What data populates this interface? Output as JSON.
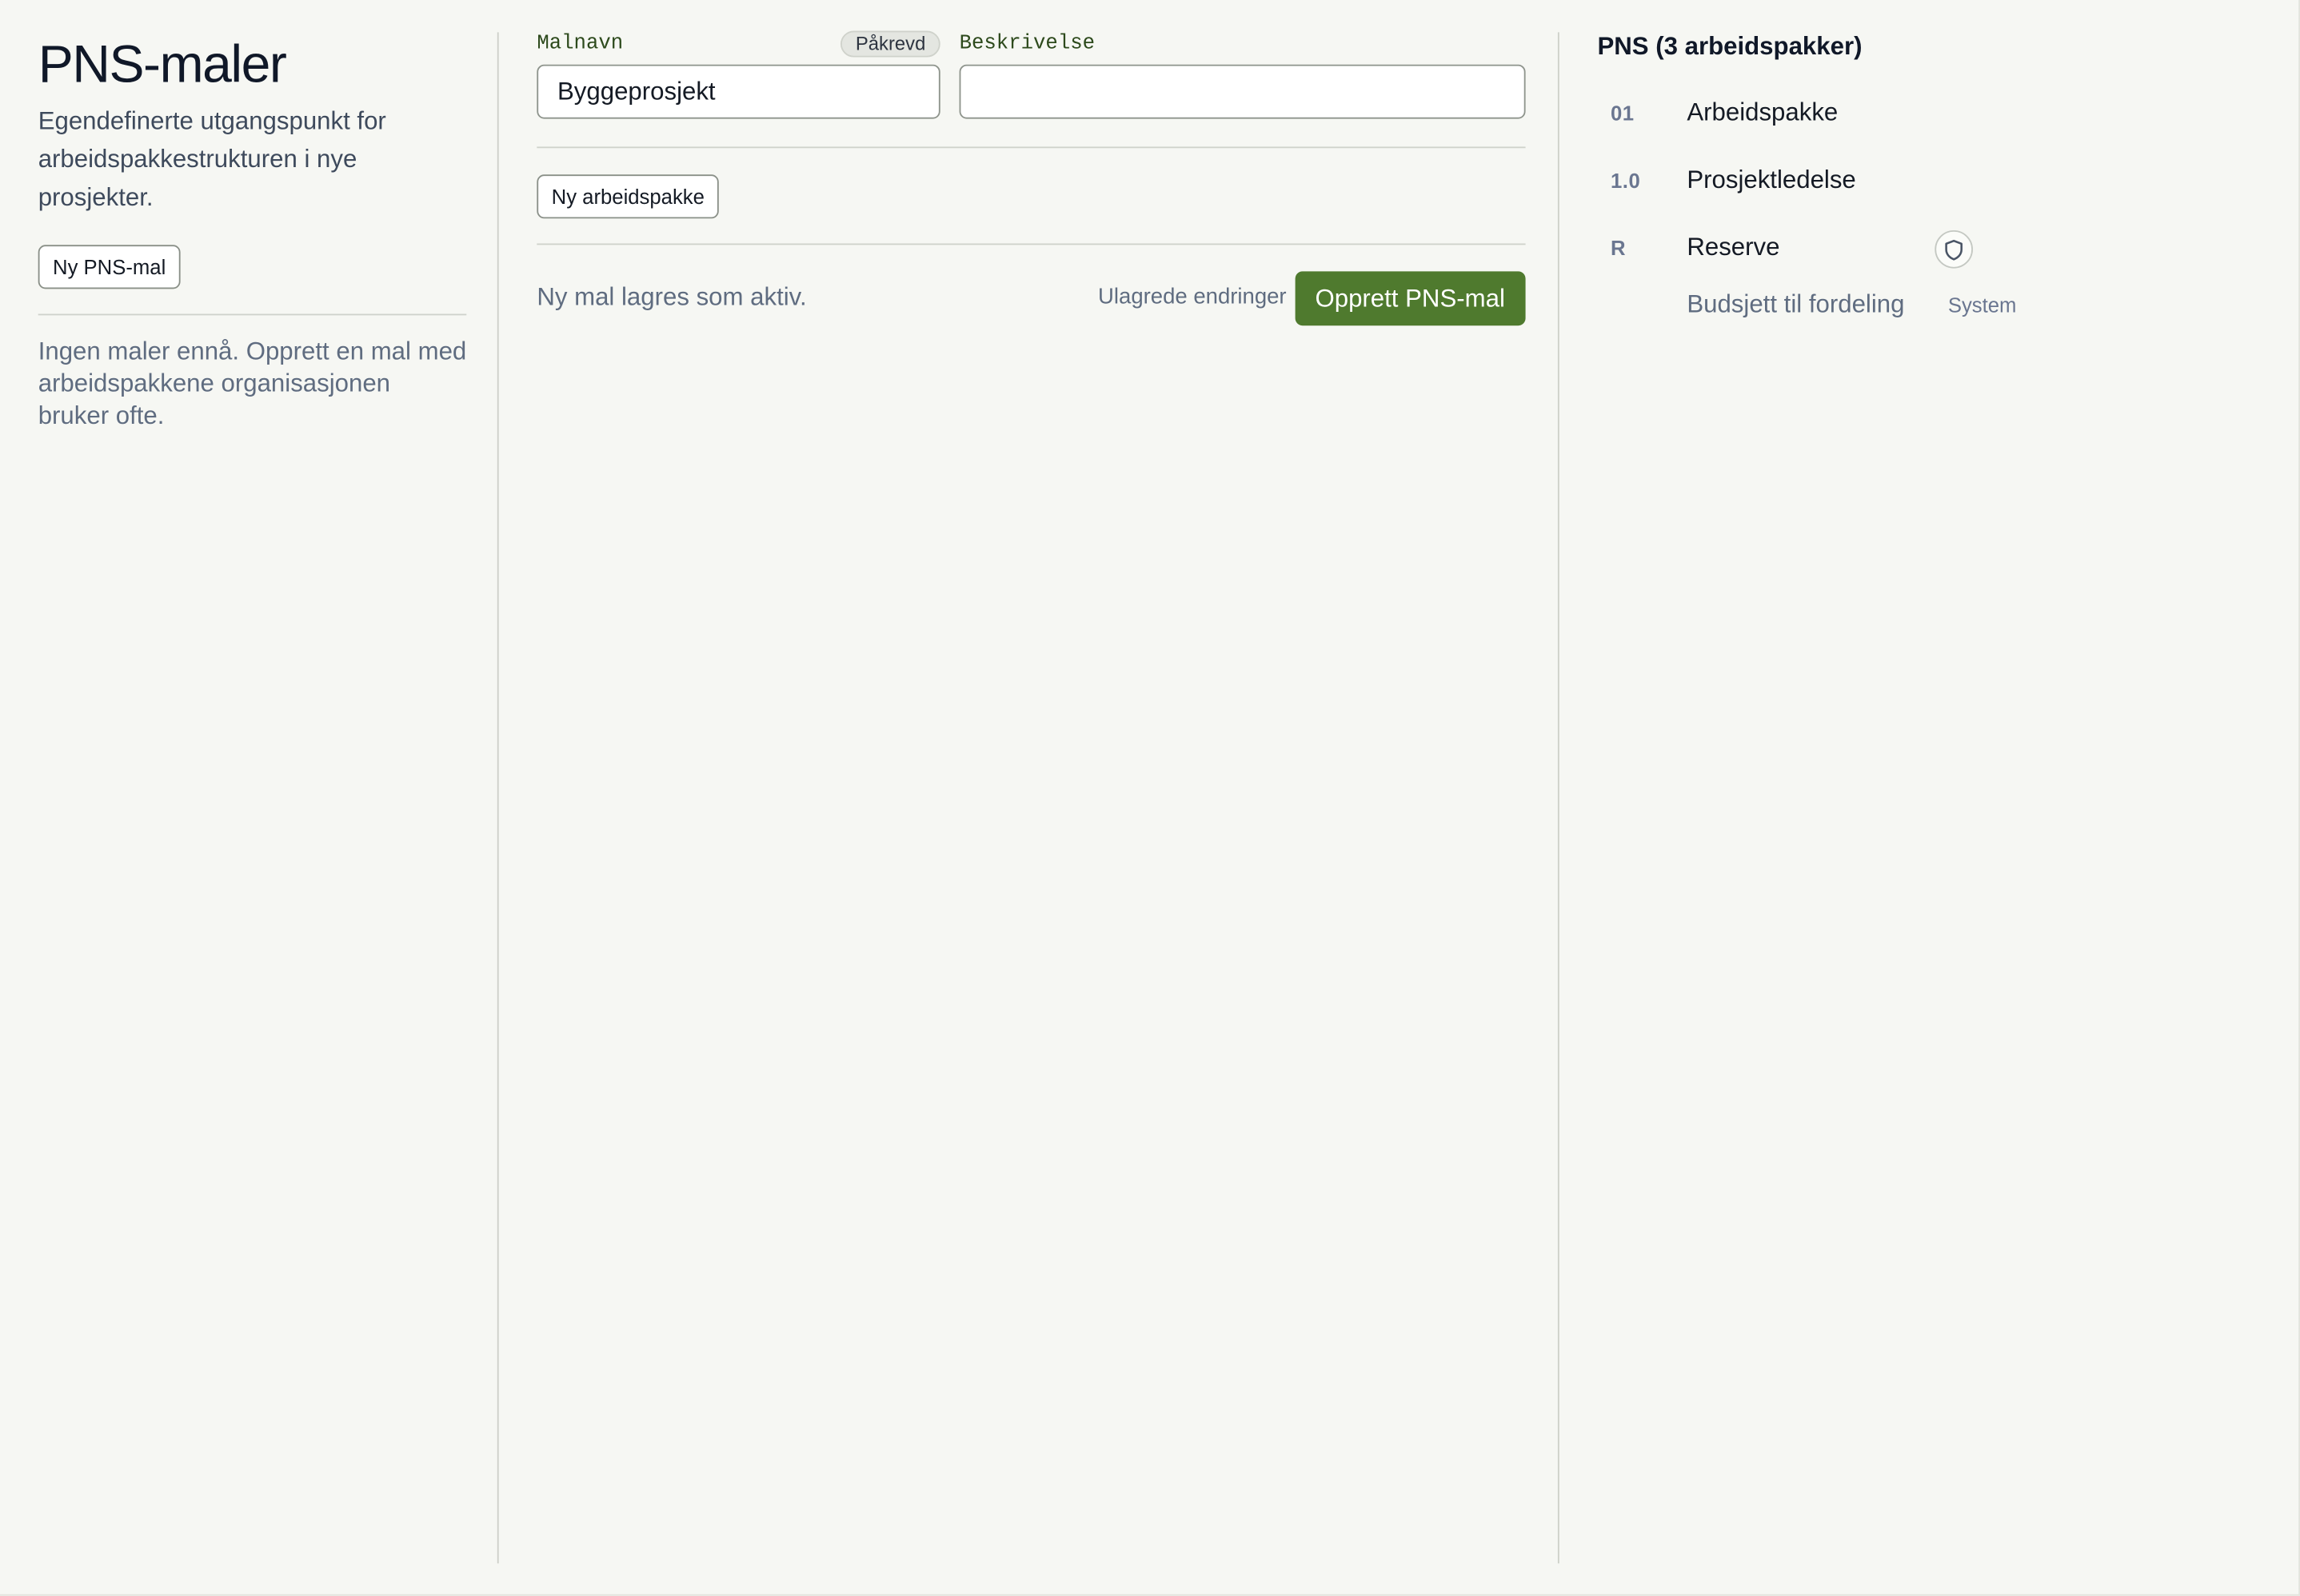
{
  "sidebar": {
    "title": "PNS-maler",
    "subtitle": "Egendefinerte utgangspunkt for arbeidspakkestrukturen i nye prosjekter.",
    "new_template_label": "Ny PNS-mal",
    "empty_message": "Ingen maler ennå. Opprett en mal med arbeidspakkene organisasjonen bruker ofte."
  },
  "form": {
    "name_label": "Malnavn",
    "required_badge": "Påkrevd",
    "name_value": "Byggeprosjekt",
    "description_label": "Beskrivelse",
    "description_value": "",
    "new_package_label": "Ny arbeidspakke",
    "status_text": "Ny mal lagres som aktiv.",
    "unsaved_text": "Ulagrede endringer",
    "submit_label": "Opprett PNS-mal"
  },
  "tree": {
    "title": "PNS (3 arbeidspakker)",
    "items": [
      {
        "code": "01",
        "name": "Arbeidspakke"
      },
      {
        "code": "1.0",
        "name": "Prosjektledelse"
      },
      {
        "code": "R",
        "name": "Reserve",
        "icon": "shield-icon",
        "sub_label": "Budsjett til fordeling",
        "tag": "System"
      }
    ]
  },
  "colors": {
    "accent": "#4f7a2e",
    "background": "#f6f7f3",
    "label": "#2d4a1c",
    "muted_text": "#5f6c80"
  }
}
